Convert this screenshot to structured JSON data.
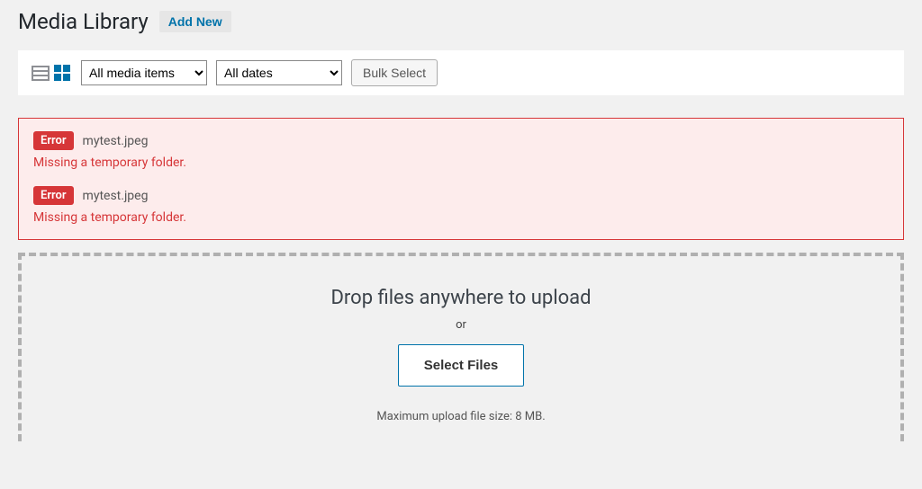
{
  "header": {
    "title": "Media Library",
    "add_new": "Add New"
  },
  "toolbar": {
    "filter_type_selected": "All media items",
    "filter_date_selected": "All dates",
    "bulk_select": "Bulk Select"
  },
  "errors": [
    {
      "badge": "Error",
      "filename": "mytest.jpeg",
      "message": "Missing a temporary folder."
    },
    {
      "badge": "Error",
      "filename": "mytest.jpeg",
      "message": "Missing a temporary folder."
    }
  ],
  "dropzone": {
    "title": "Drop files anywhere to upload",
    "or": "or",
    "select_files": "Select Files",
    "max_size": "Maximum upload file size: 8 MB."
  },
  "colors": {
    "accent": "#0073aa",
    "error": "#d63638",
    "background": "#f1f1f1"
  }
}
